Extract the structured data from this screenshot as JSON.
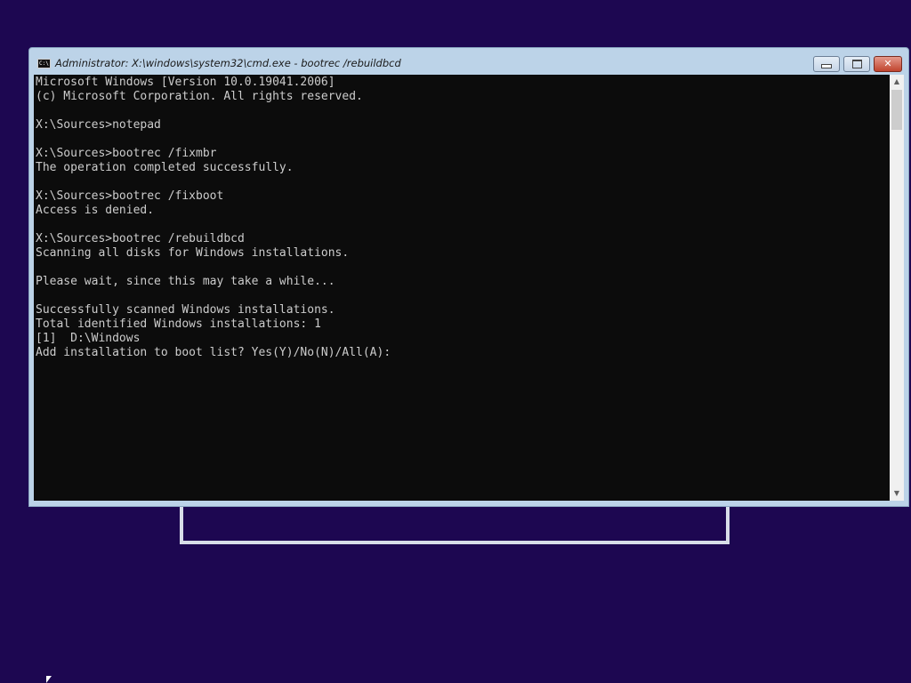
{
  "window": {
    "title": "Administrator: X:\\windows\\system32\\cmd.exe - bootrec  /rebuildbcd",
    "icon_text": "C:\\",
    "close_glyph": "✕"
  },
  "console": {
    "lines": [
      "Microsoft Windows [Version 10.0.19041.2006]",
      "(c) Microsoft Corporation. All rights reserved.",
      "",
      "X:\\Sources>notepad",
      "",
      "X:\\Sources>bootrec /fixmbr",
      "The operation completed successfully.",
      "",
      "X:\\Sources>bootrec /fixboot",
      "Access is denied.",
      "",
      "X:\\Sources>bootrec /rebuildbcd",
      "Scanning all disks for Windows installations.",
      "",
      "Please wait, since this may take a while...",
      "",
      "Successfully scanned Windows installations.",
      "Total identified Windows installations: 1",
      "[1]  D:\\Windows",
      "Add installation to boot list? Yes(Y)/No(N)/All(A):"
    ]
  },
  "scrollbar": {
    "up_glyph": "▲",
    "down_glyph": "▼"
  },
  "colors": {
    "desktop": "#1d0751",
    "console_bg": "#0c0c0c",
    "console_text": "#cccccc",
    "frame": "#bcd3e8"
  }
}
